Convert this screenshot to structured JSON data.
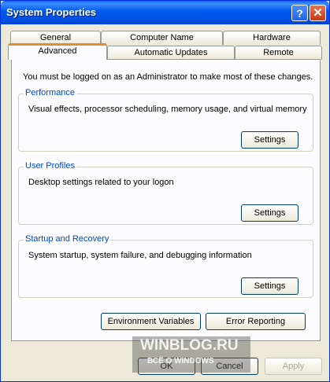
{
  "window": {
    "title": "System Properties"
  },
  "titlebar": {
    "help_glyph": "?",
    "close_glyph": "✕"
  },
  "tabs": {
    "row1": [
      "General",
      "Computer Name",
      "Hardware"
    ],
    "row2": [
      "Advanced",
      "Automatic Updates",
      "Remote"
    ],
    "active": "Advanced"
  },
  "advanced": {
    "intro": "You must be logged on as an Administrator to make most of these changes.",
    "groups": [
      {
        "title": "Performance",
        "description": "Visual effects, processor scheduling, memory usage, and virtual memory",
        "button": "Settings"
      },
      {
        "title": "User Profiles",
        "description": "Desktop settings related to your logon",
        "button": "Settings"
      },
      {
        "title": "Startup and Recovery",
        "description": "System startup, system failure, and debugging information",
        "button": "Settings"
      }
    ],
    "env_button": "Environment Variables",
    "error_button": "Error Reporting"
  },
  "footer": {
    "ok": "OK",
    "cancel": "Cancel",
    "apply": "Apply"
  },
  "watermark": {
    "line1": "WINBLOG.RU",
    "line2": "ВСЁ О WINDOWS"
  },
  "colors": {
    "titlebar": "#0058ee",
    "accent_tab": "#e68b2c",
    "group_title": "#0046d5",
    "face": "#ece9d8"
  }
}
